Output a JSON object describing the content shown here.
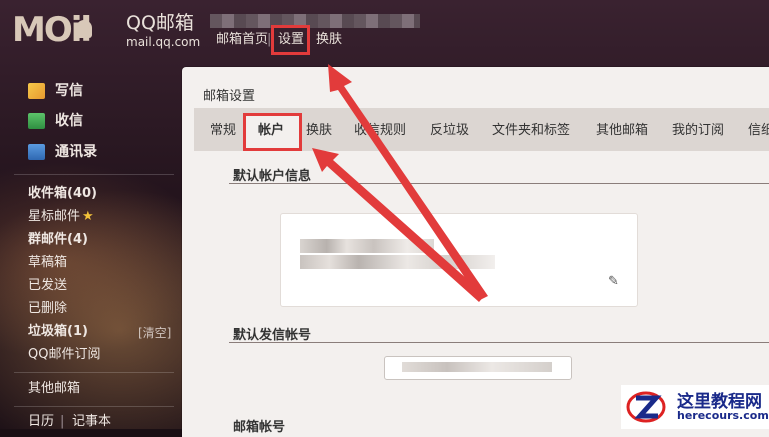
{
  "header": {
    "logo_letters": "MOil",
    "brand": "QQ邮箱",
    "domain": "mail.qq.com",
    "nav": {
      "home": "邮箱首页",
      "separator": "|",
      "settings": "设置",
      "skin": "换肤"
    }
  },
  "sidebar": {
    "compose": "写信",
    "inbox_action": "收信",
    "contacts": "通讯录",
    "folders": [
      "收件箱(40)",
      "星标邮件",
      "群邮件(4)",
      "草稿箱",
      "已发送",
      "已删除",
      "垃圾箱(1)",
      "QQ邮件订阅"
    ],
    "clear": "[清空]",
    "other": "其他邮箱",
    "bottom": {
      "calendar": "日历",
      "separator": "|",
      "notes": "记事本"
    }
  },
  "main": {
    "title": "邮箱设置",
    "tabs": [
      "常规",
      "帐户",
      "换肤",
      "收信规则",
      "反垃圾",
      "文件夹和标签",
      "其他邮箱",
      "我的订阅",
      "信纸"
    ],
    "active_tab": "帐户",
    "sections": {
      "default_account": "默认帐户信息",
      "default_sender": "默认发信帐号",
      "mail_account": "邮箱帐号"
    }
  },
  "watermark": {
    "name": "这里教程网",
    "url": "herecours.com"
  },
  "colors": {
    "highlight": "#e23b3b",
    "panel": "#f3f0ee",
    "tabs_bar": "#dcd6d2",
    "star": "#f3c23a"
  }
}
